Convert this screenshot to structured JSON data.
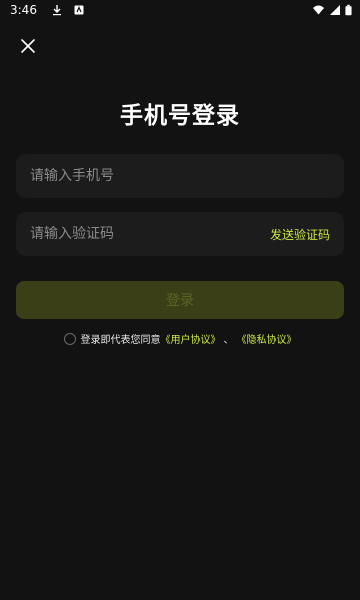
{
  "status_bar": {
    "time": "3:46",
    "icons": [
      "download-icon",
      "notification-icon",
      "wifi-icon",
      "signal-icon",
      "battery-icon"
    ]
  },
  "page": {
    "title": "手机号登录"
  },
  "phone_field": {
    "placeholder": "请输入手机号",
    "value": ""
  },
  "code_field": {
    "placeholder": "请输入验证码",
    "value": "",
    "send_label": "发送验证码"
  },
  "login_button": {
    "label": "登录"
  },
  "agreement": {
    "text": "登录即代表您同意",
    "user_agreement": "《用户协议》",
    "separator": "、",
    "privacy_policy": "《隐私协议》",
    "checked": false
  },
  "colors": {
    "background": "#121212",
    "field_bg": "#1c1c1c",
    "accent": "#c8e646",
    "button_disabled_bg": "#3a3f18"
  }
}
